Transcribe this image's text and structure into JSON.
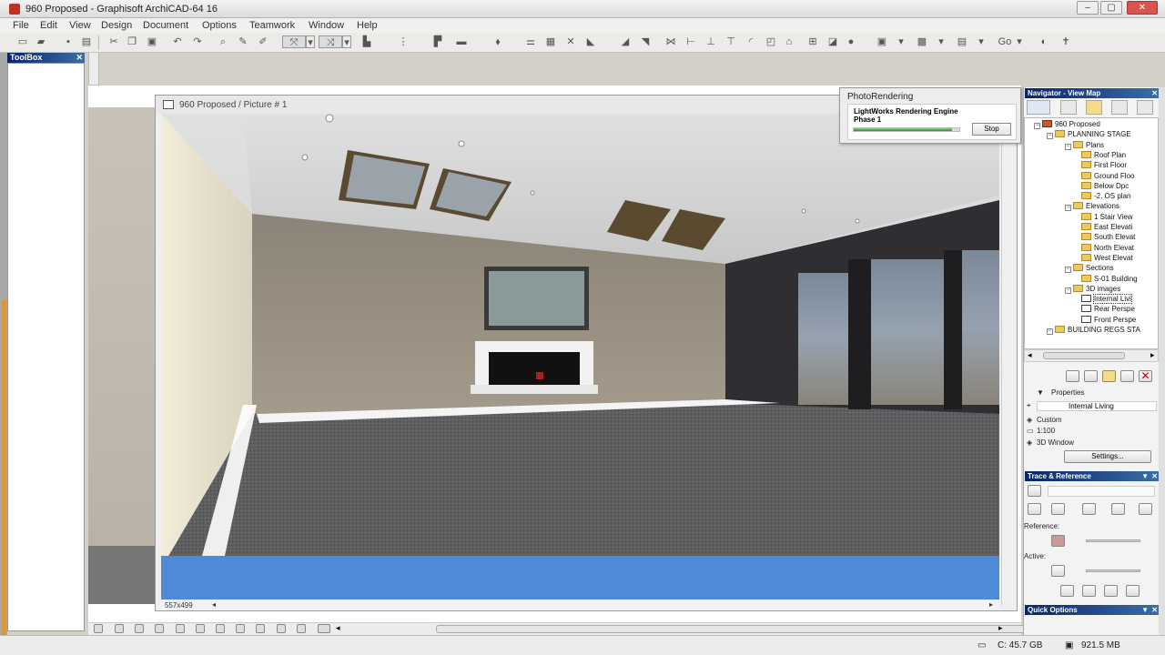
{
  "window": {
    "title": "960 Proposed - Graphisoft ArchiCAD-64 16",
    "min": "–",
    "max": "▢",
    "close": "✕"
  },
  "menu": [
    "File",
    "Edit",
    "View",
    "Design",
    "Document",
    "Options",
    "Teamwork",
    "Window",
    "Help"
  ],
  "toolbar": {
    "go_label": "Go"
  },
  "toolbox": {
    "title": "ToolBox",
    "close": "✕"
  },
  "picture_window": {
    "title": "960 Proposed / Picture # 1",
    "size_label": "557x499"
  },
  "photo_rendering": {
    "title": "PhotoRendering",
    "engine": "LightWorks Rendering Engine",
    "phase": "Phase 1",
    "progress": 0.93,
    "stop_label": "Stop"
  },
  "navigator": {
    "title": "Navigator - View Map",
    "tree": [
      {
        "label": "960 Proposed",
        "level": 0,
        "kind": "project"
      },
      {
        "label": "PLANNING STAGE",
        "level": 1,
        "kind": "folder"
      },
      {
        "label": "Plans",
        "level": 2,
        "kind": "folder"
      },
      {
        "label": "Roof Plan",
        "level": 3,
        "kind": "view"
      },
      {
        "label": "First Floor",
        "level": 3,
        "kind": "view"
      },
      {
        "label": "Ground Floo",
        "level": 3,
        "kind": "view"
      },
      {
        "label": "Below Dpc",
        "level": 3,
        "kind": "view"
      },
      {
        "label": "-2. OS plan",
        "level": 3,
        "kind": "view"
      },
      {
        "label": "Elevations",
        "level": 2,
        "kind": "folder"
      },
      {
        "label": "1 Stair View",
        "level": 3,
        "kind": "view"
      },
      {
        "label": "East Elevati",
        "level": 3,
        "kind": "view"
      },
      {
        "label": "South Elevat",
        "level": 3,
        "kind": "view"
      },
      {
        "label": "North Elevat",
        "level": 3,
        "kind": "view"
      },
      {
        "label": "West Elevat",
        "level": 3,
        "kind": "view"
      },
      {
        "label": "Sections",
        "level": 2,
        "kind": "folder"
      },
      {
        "label": "S-01 Building",
        "level": 3,
        "kind": "view"
      },
      {
        "label": "3D images",
        "level": 2,
        "kind": "folder"
      },
      {
        "label": "Internal Livi",
        "level": 3,
        "kind": "camera",
        "selected": true
      },
      {
        "label": "Rear Perspe",
        "level": 3,
        "kind": "camera"
      },
      {
        "label": "Front Perspe",
        "level": 3,
        "kind": "camera"
      },
      {
        "label": "BUILDING REGS STA",
        "level": 1,
        "kind": "folder"
      }
    ]
  },
  "properties": {
    "title": "Properties",
    "name": "Internal Living",
    "custom": "Custom",
    "scale": "1:100",
    "window": "3D Window",
    "settings_label": "Settings..."
  },
  "trace": {
    "title": "Trace & Reference",
    "reference_label": "Reference:",
    "active_label": "Active:"
  },
  "quick_options": {
    "title": "Quick Options"
  },
  "status": {
    "disk": "C: 45.7 GB",
    "memory": "921.5 MB"
  }
}
